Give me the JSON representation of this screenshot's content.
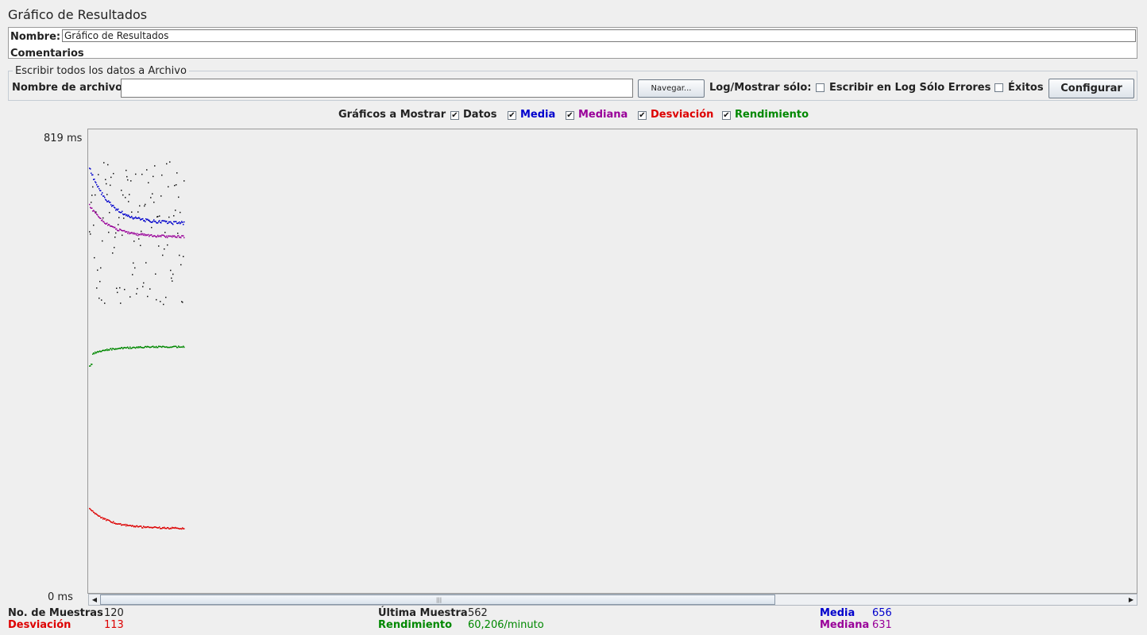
{
  "title": "Gráfico de Resultados",
  "name_label": "Nombre:",
  "name_value": "Gráfico de Resultados",
  "comments_label": "Comentarios",
  "file_group": {
    "title": "Escribir todos los datos a Archivo",
    "filename_label": "Nombre de archivo",
    "filename_value": "",
    "browse_label": "Navegar...",
    "log_label": "Log/Mostrar sólo:",
    "errors_label": "Escribir en Log Sólo Errores",
    "errors_checked": false,
    "success_label": "Éxitos",
    "success_checked": false,
    "configure_label": "Configurar"
  },
  "graphs": {
    "label": "Gráficos a Mostrar",
    "toggles": [
      {
        "label": "Datos",
        "color": "#111111",
        "checked": true
      },
      {
        "label": "Media",
        "color": "#0000cc",
        "checked": true
      },
      {
        "label": "Mediana",
        "color": "#990099",
        "checked": true
      },
      {
        "label": "Desviación",
        "color": "#dd0000",
        "checked": true
      },
      {
        "label": "Rendimiento",
        "color": "#008800",
        "checked": true
      }
    ]
  },
  "chart": {
    "y_max_label": "819  ms",
    "y_min_label": "0  ms"
  },
  "stats": {
    "samples_label": "No. de Muestras",
    "samples_value": "120",
    "deviation_label": "Desviación",
    "deviation_value": "113",
    "last_label": "Última Muestra",
    "last_value": "562",
    "throughput_label": "Rendimiento",
    "throughput_value": "60,206/minuto",
    "mean_label": "Media",
    "mean_value": "656",
    "median_label": "Mediana",
    "median_value": "631"
  }
}
